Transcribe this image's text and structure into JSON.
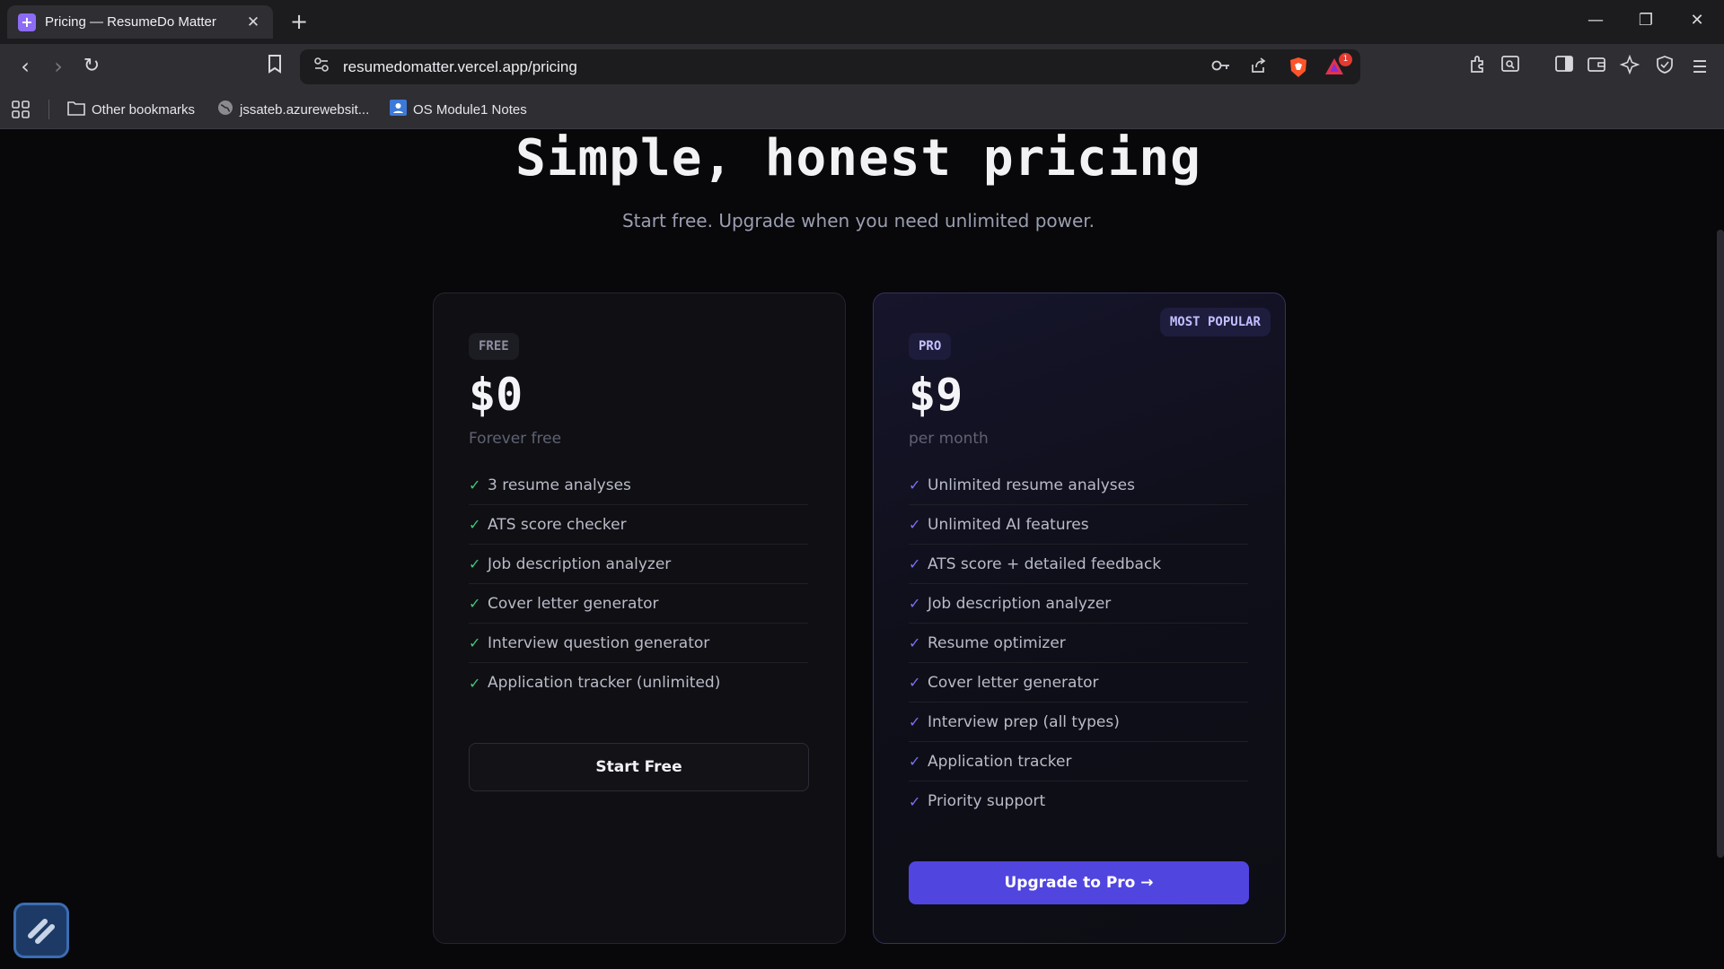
{
  "browser": {
    "tab_title": "Pricing — ResumeDo Matter",
    "url": "resumedomatter.vercel.app/pricing",
    "rewards_count": "1",
    "bookmarks": [
      {
        "label": "Other bookmarks",
        "icon": "folder-icon"
      },
      {
        "label": "jssateb.azurewebsit...",
        "icon": "globe-icon"
      },
      {
        "label": "OS Module1 Notes",
        "icon": "contact-icon"
      }
    ]
  },
  "hero": {
    "title": "Simple, honest pricing",
    "subtitle": "Start free. Upgrade when you need unlimited power."
  },
  "plans": {
    "free": {
      "tag": "FREE",
      "price": "$0",
      "period": "Forever free",
      "features": [
        "3 resume analyses",
        "ATS score checker",
        "Job description analyzer",
        "Cover letter generator",
        "Interview question generator",
        "Application tracker (unlimited)"
      ],
      "cta": "Start Free"
    },
    "pro": {
      "badge": "MOST POPULAR",
      "tag": "PRO",
      "price": "$9",
      "period": "per month",
      "features": [
        "Unlimited resume analyses",
        "Unlimited AI features",
        "ATS score + detailed feedback",
        "Job description analyzer",
        "Resume optimizer",
        "Cover letter generator",
        "Interview prep (all types)",
        "Application tracker",
        "Priority support"
      ],
      "cta": "Upgrade to Pro →"
    }
  },
  "colors": {
    "accent": "#5145e0",
    "check_free": "#3fc87a",
    "check_pro": "#7b70f5"
  }
}
